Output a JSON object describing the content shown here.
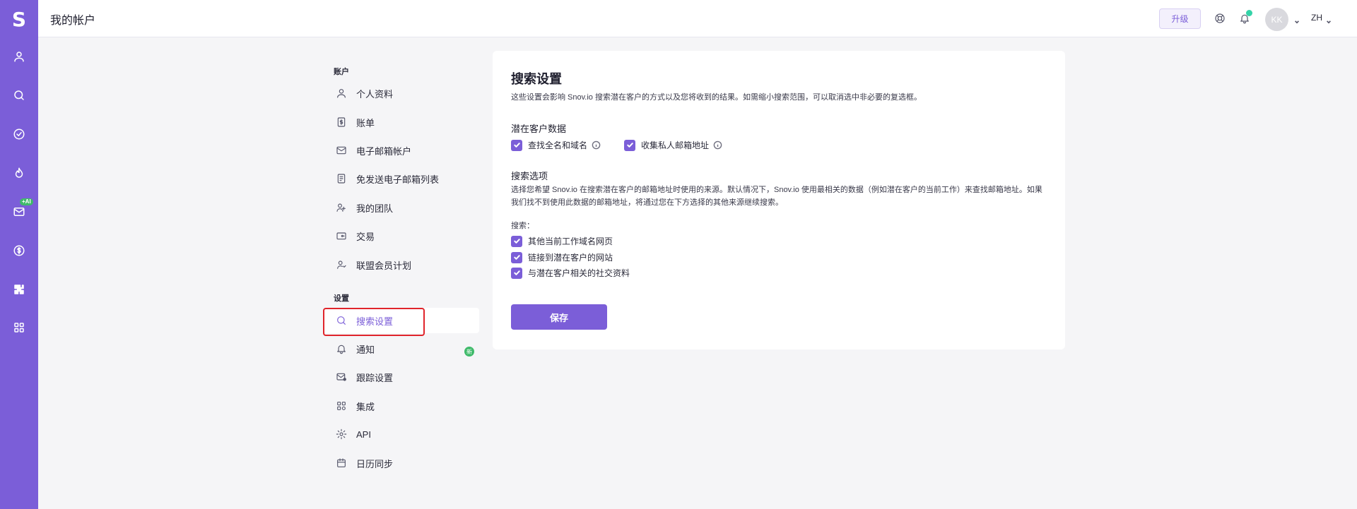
{
  "rail": {
    "logo": "S",
    "ai_badge": "+AI"
  },
  "header": {
    "title": "我的帐户",
    "upgrade_label": "升级",
    "avatar_initials": "KK",
    "language": "ZH"
  },
  "nav": {
    "account_section": "账户",
    "account_items": [
      {
        "label": "个人资料",
        "icon": "user-icon"
      },
      {
        "label": "账单",
        "icon": "invoice-icon"
      },
      {
        "label": "电子邮箱帐户",
        "icon": "mail-icon"
      },
      {
        "label": "免发送电子邮箱列表",
        "icon": "list-icon"
      },
      {
        "label": "我的团队",
        "icon": "team-icon"
      },
      {
        "label": "交易",
        "icon": "wallet-icon"
      },
      {
        "label": "联盟会员计划",
        "icon": "affiliate-icon"
      }
    ],
    "settings_section": "设置",
    "settings_items": [
      {
        "label": "搜索设置",
        "icon": "search-icon",
        "active": true
      },
      {
        "label": "通知",
        "icon": "bell-icon",
        "badge": "新"
      },
      {
        "label": "跟踪设置",
        "icon": "mail-tracking-icon"
      },
      {
        "label": "集成",
        "icon": "integrations-icon"
      },
      {
        "label": "API",
        "icon": "gear-icon"
      },
      {
        "label": "日历同步",
        "icon": "calendar-icon"
      }
    ]
  },
  "card": {
    "title": "搜索设置",
    "description": "这些设置会影响 Snov.io 搜索潜在客户的方式以及您将收到的结果。如需缩小搜索范围，可以取消选中非必要的复选框。",
    "prospect_section": {
      "title": "潜在客户数据",
      "options": [
        {
          "label": "查找全名和域名",
          "checked": true
        },
        {
          "label": "收集私人邮箱地址",
          "checked": true
        }
      ]
    },
    "search_section": {
      "title": "搜索选项",
      "description": "选择您希望 Snov.io 在搜索潜在客户的邮箱地址时使用的来源。默认情况下，Snov.io 使用最相关的数据（例如潜在客户的当前工作）来查找邮箱地址。如果我们找不到使用此数据的邮箱地址，将通过您在下方选择的其他来源继续搜索。",
      "search_label": "搜索：",
      "options": [
        {
          "label": "其他当前工作域名网页",
          "checked": true
        },
        {
          "label": "链接到潜在客户的网站",
          "checked": true
        },
        {
          "label": "与潜在客户相关的社交资料",
          "checked": true
        }
      ]
    },
    "save_label": "保存"
  }
}
